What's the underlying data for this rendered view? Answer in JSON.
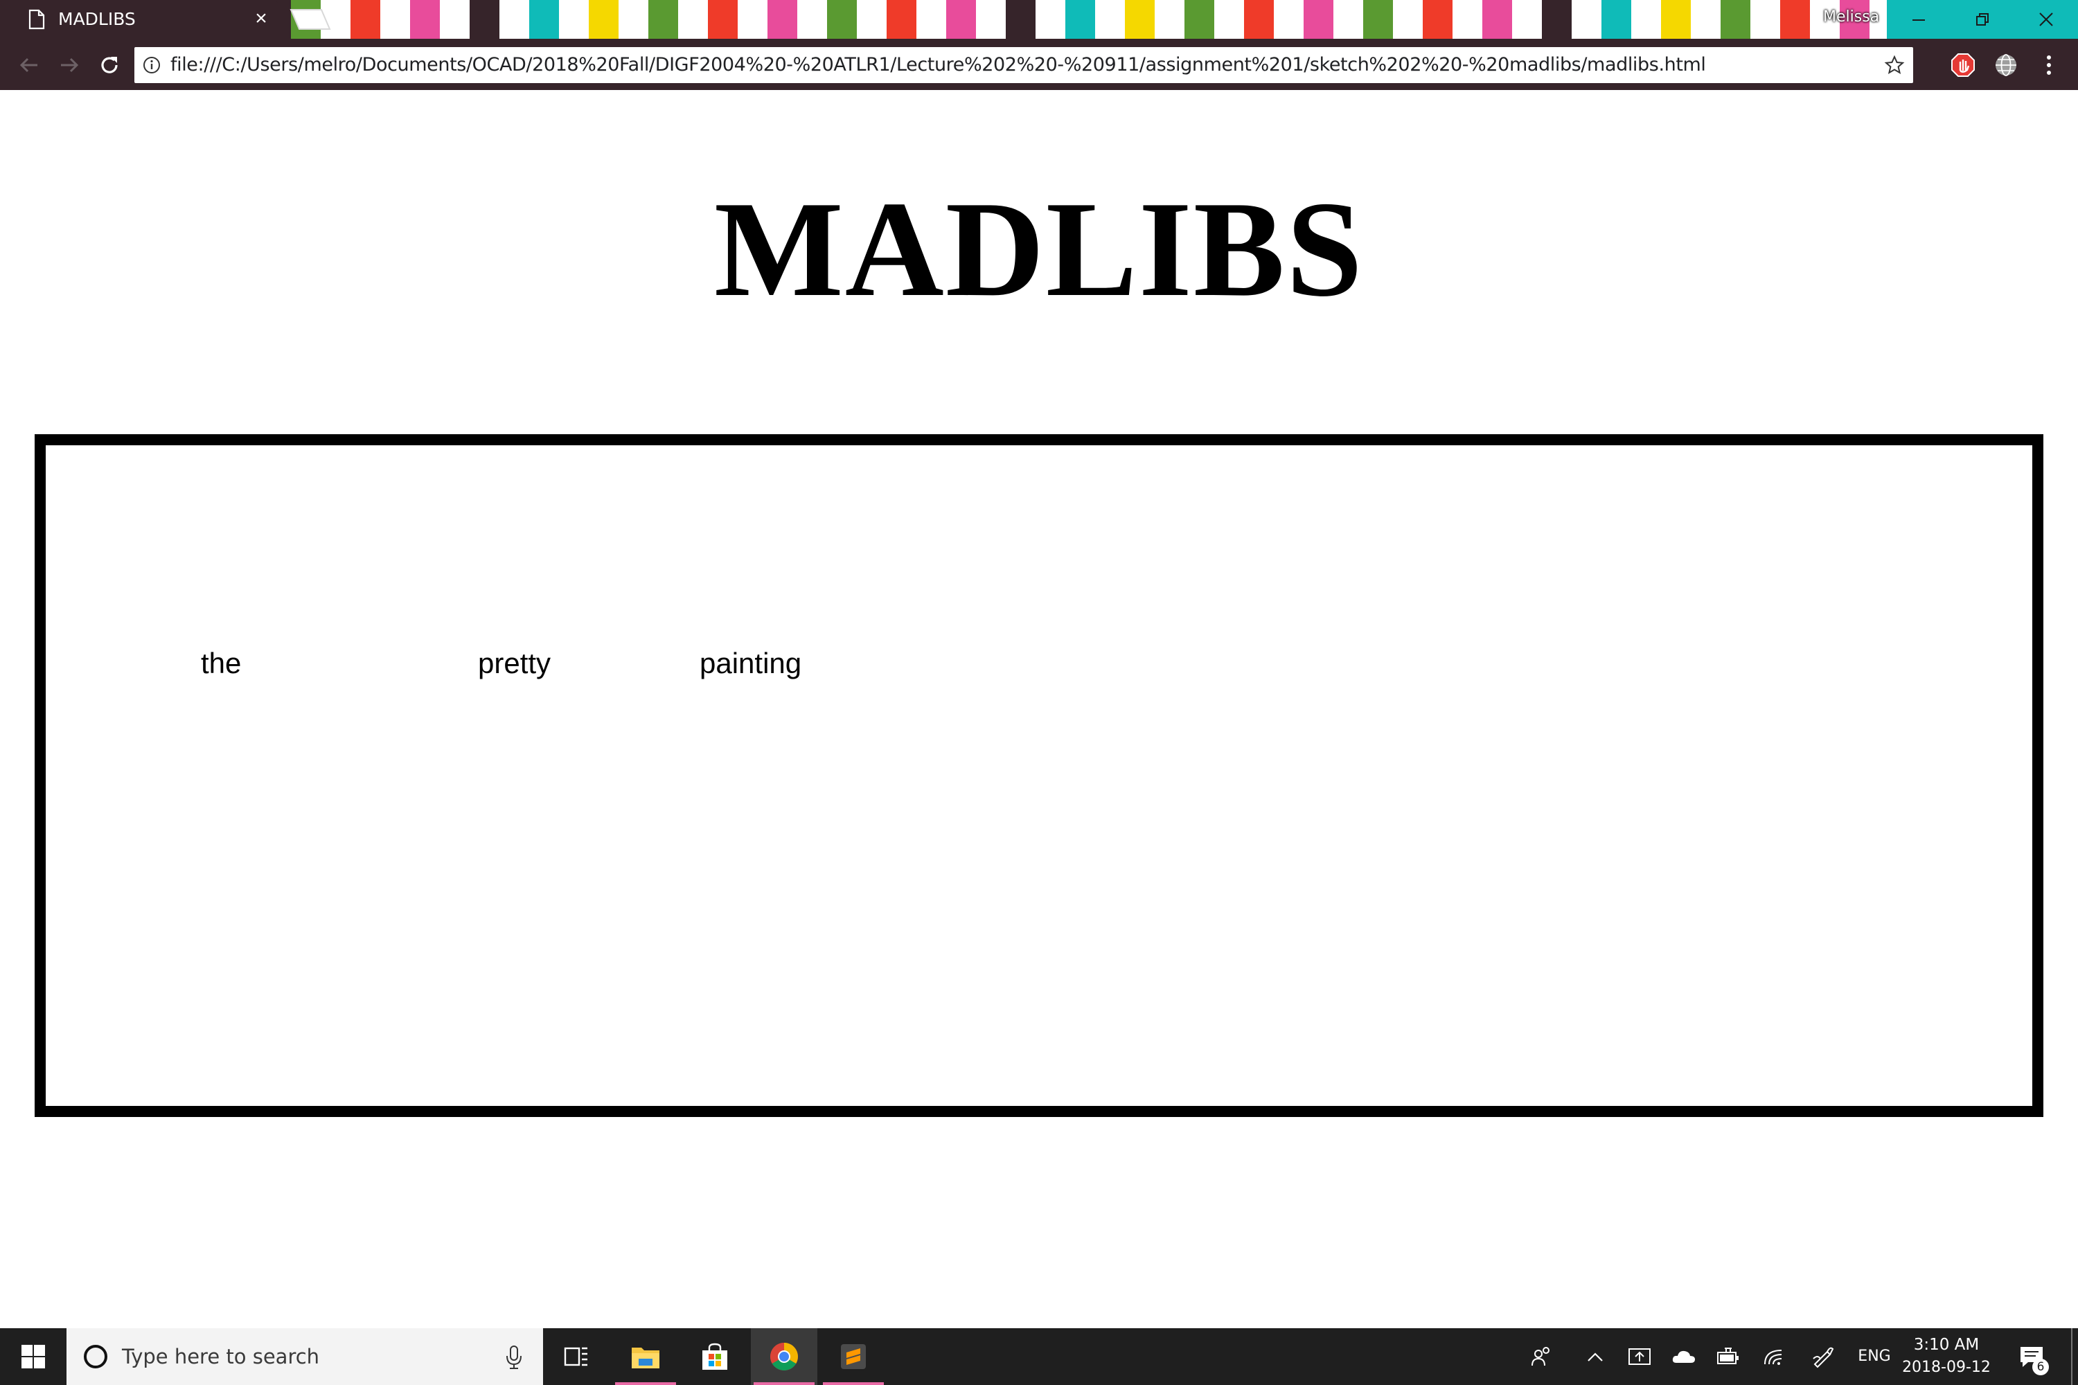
{
  "browser": {
    "tab_title": "MADLIBS",
    "tab_close": "×",
    "profile_name": "Melissa",
    "url": "file:///C:/Users/melro/Documents/OCAD/2018%20Fall/DIGF2004%20-%20ATLR1/Lecture%202%20-%20911/assignment%201/sketch%202%20-%20madlibs/madlibs.html",
    "theme_colors": {
      "frame": "#36242a",
      "window_buttons": "#0fbbb8",
      "stripe_palette": [
        "#ffffff",
        "#5a9a31",
        "#ef3b29",
        "#e84c9b",
        "#0fbbb8",
        "#f5d800"
      ]
    }
  },
  "page": {
    "heading": "MADLIBS",
    "words": [
      "the",
      "pretty",
      "painting"
    ]
  },
  "taskbar": {
    "search_placeholder": "Type here to search",
    "language": "ENG",
    "time": "3:10 AM",
    "date": "2018-09-12",
    "notification_count": "6",
    "pinned_apps": [
      "task-view",
      "file-explorer",
      "microsoft-store",
      "chrome",
      "sublime-text"
    ]
  }
}
